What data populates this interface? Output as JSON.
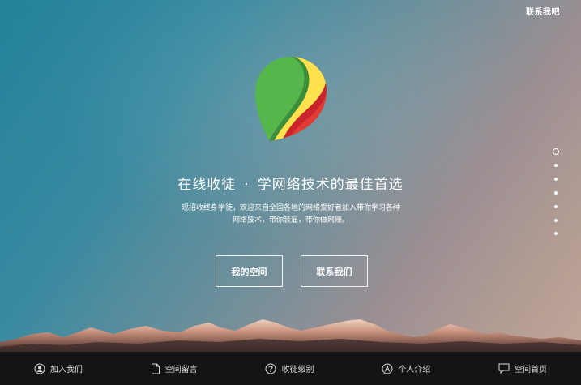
{
  "header": {
    "contact_link": "联系我吧"
  },
  "hero": {
    "title_left": "在线收徒",
    "title_sep": "·",
    "title_right": "学网络技术的最佳首选",
    "description": "现招收终身学徒，欢迎来自全国各地的网络爱好者加入带你学习各种网络技术，带你装逼，带你做网赚。"
  },
  "buttons": {
    "my_space": "我的空间",
    "contact_us": "联系我们"
  },
  "page_dots": {
    "count": 7,
    "active_index": 0
  },
  "logo": {
    "colors": [
      "#55b74b",
      "#ffe14d",
      "#d9302c"
    ]
  },
  "footer_nav": [
    {
      "label": "加入我们",
      "icon": "user-icon"
    },
    {
      "label": "空间留言",
      "icon": "document-icon"
    },
    {
      "label": "收徒级别",
      "icon": "question-icon"
    },
    {
      "label": "个人介绍",
      "icon": "letter-a-icon"
    },
    {
      "label": "空间首页",
      "icon": "chat-icon"
    }
  ]
}
